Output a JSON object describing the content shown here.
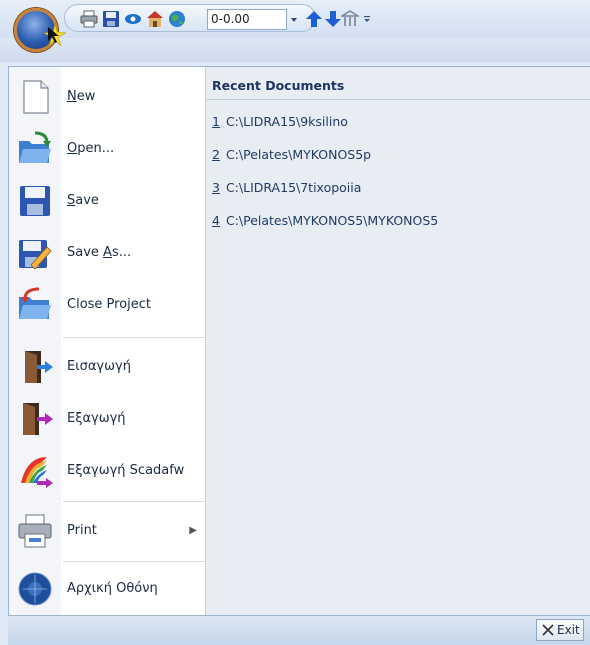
{
  "toolbar": {
    "elevation_value": "0-0.00",
    "icons": [
      "print-icon",
      "save-icon",
      "view-icon",
      "house-icon",
      "globe-icon",
      "arrow-up-icon",
      "arrow-down-icon",
      "building-icon",
      "customize-icon"
    ]
  },
  "menu": {
    "items": [
      {
        "label": "New",
        "mnemonic": "N",
        "rest": "ew",
        "icon": "new-document-icon"
      },
      {
        "label": "Open...",
        "mnemonic": "O",
        "rest": "pen...",
        "icon": "open-folder-icon"
      },
      {
        "label": "Save",
        "mnemonic": "S",
        "rest": "ave",
        "icon": "floppy-icon"
      },
      {
        "label": "Save As...",
        "pre": "Save ",
        "mnemonic": "A",
        "rest": "s...",
        "icon": "save-as-icon"
      },
      {
        "label": "Close Project",
        "icon": "close-project-icon"
      },
      {
        "label": "Εισαγωγή",
        "icon": "import-door-icon"
      },
      {
        "label": "Εξαγωγή",
        "icon": "export-door-icon"
      },
      {
        "label": "Εξαγωγή Scadafw",
        "icon": "export-scada-icon"
      },
      {
        "label": "Print",
        "icon": "printer-icon"
      },
      {
        "label": "Αρχική Οθόνη",
        "icon": "home-globe-icon"
      }
    ],
    "recent_title": "Recent Documents",
    "recent": [
      {
        "n": "1",
        "path": "C:\\LIDRA15\\9ksilino"
      },
      {
        "n": "2",
        "path": "C:\\Pelates\\MYKONOS5p"
      },
      {
        "n": "3",
        "path": "C:\\LIDRA15\\7tixopoiia"
      },
      {
        "n": "4",
        "path": "C:\\Pelates\\MYKONOS5\\MYKONOS5"
      }
    ],
    "exit_label": "Exit"
  }
}
